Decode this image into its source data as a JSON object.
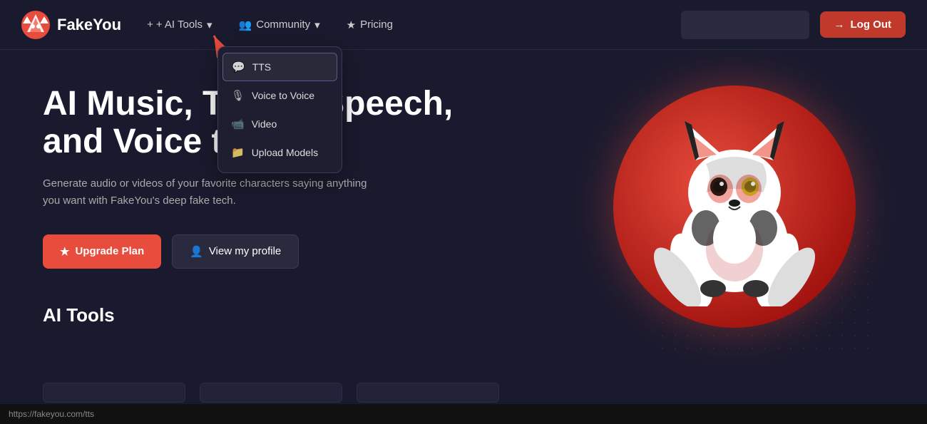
{
  "site": {
    "logo_text": "FakeYou",
    "url": "https://fakeyou.com/tts"
  },
  "navbar": {
    "ai_tools_label": "+ AI Tools",
    "community_label": "Community",
    "pricing_label": "Pricing",
    "logout_label": "Log Out"
  },
  "dropdown": {
    "items": [
      {
        "id": "tts",
        "label": "TTS",
        "active": true
      },
      {
        "id": "voice-to-voice",
        "label": "Voice to Voice",
        "active": false
      },
      {
        "id": "video",
        "label": "Video",
        "active": false
      },
      {
        "id": "upload-models",
        "label": "Upload Models",
        "active": false
      }
    ]
  },
  "hero": {
    "title": "AI Music, Text to Speech, and Voice to voice",
    "subtitle": "Generate audio or videos of your favorite characters saying anything you want with FakeYou's deep fake tech.",
    "upgrade_btn": "Upgrade Plan",
    "profile_btn": "View my profile"
  },
  "ai_tools_section": {
    "title": "AI Tools"
  },
  "icons": {
    "logo": "🐺",
    "tts": "💬",
    "voice_to_voice": "🎙",
    "video": "📹",
    "upload": "📁",
    "star": "★",
    "user": "👤",
    "logout_icon": "→",
    "plus": "+",
    "community_icon": "👥",
    "pricing_icon": "★",
    "chevron": "▾"
  }
}
